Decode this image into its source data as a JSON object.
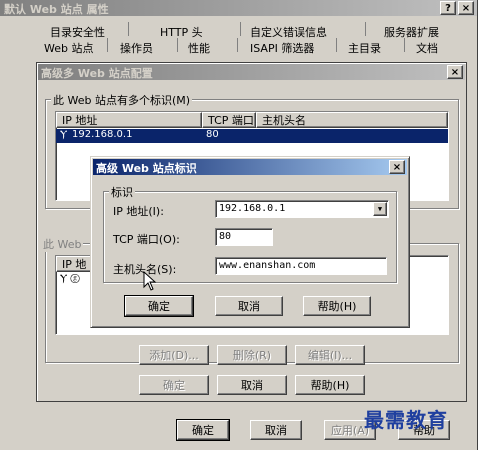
{
  "outer_window": {
    "title": "默认 Web 站点 属性",
    "help_btn": "?",
    "close_btn": "×"
  },
  "tabs_row1": [
    "目录安全性",
    "HTTP 头",
    "自定义错误信息",
    "服务器扩展"
  ],
  "tabs_row2": [
    "Web 站点",
    "操作员",
    "性能",
    "ISAPI 筛选器",
    "主目录",
    "文档"
  ],
  "multi_dialog": {
    "title": "高级多 Web 站点配置",
    "close_btn": "×",
    "group_label": "此 Web 站点有多个标识(M)",
    "columns": [
      "IP 地址",
      "TCP 端口",
      "主机头名"
    ],
    "row": {
      "ip": "192.168.0.1",
      "port": "80"
    },
    "group2_label": "此 Web",
    "columns2_first": "IP 地",
    "add_btn": "添加(D)...",
    "remove_btn": "删除(R)",
    "edit_btn": "编辑(I)...",
    "ok_btn": "确定",
    "cancel_btn": "取消",
    "help_btn": "帮助(H)"
  },
  "ident_dialog": {
    "title": "高级 Web 站点标识",
    "close_btn": "×",
    "group_label": "标识",
    "ip_label": "IP 地址(I):",
    "ip_value": "192.168.0.1",
    "port_label": "TCP 端口(O):",
    "port_value": "80",
    "host_label": "主机头名(S):",
    "host_value": "www.enanshan.com",
    "ok_btn": "确定",
    "cancel_btn": "取消",
    "help_btn": "帮助(H)"
  },
  "bottom_buttons": {
    "ok": "确定",
    "cancel": "取消",
    "apply": "应用(A)",
    "help": "帮助"
  },
  "watermark": "最需教育"
}
